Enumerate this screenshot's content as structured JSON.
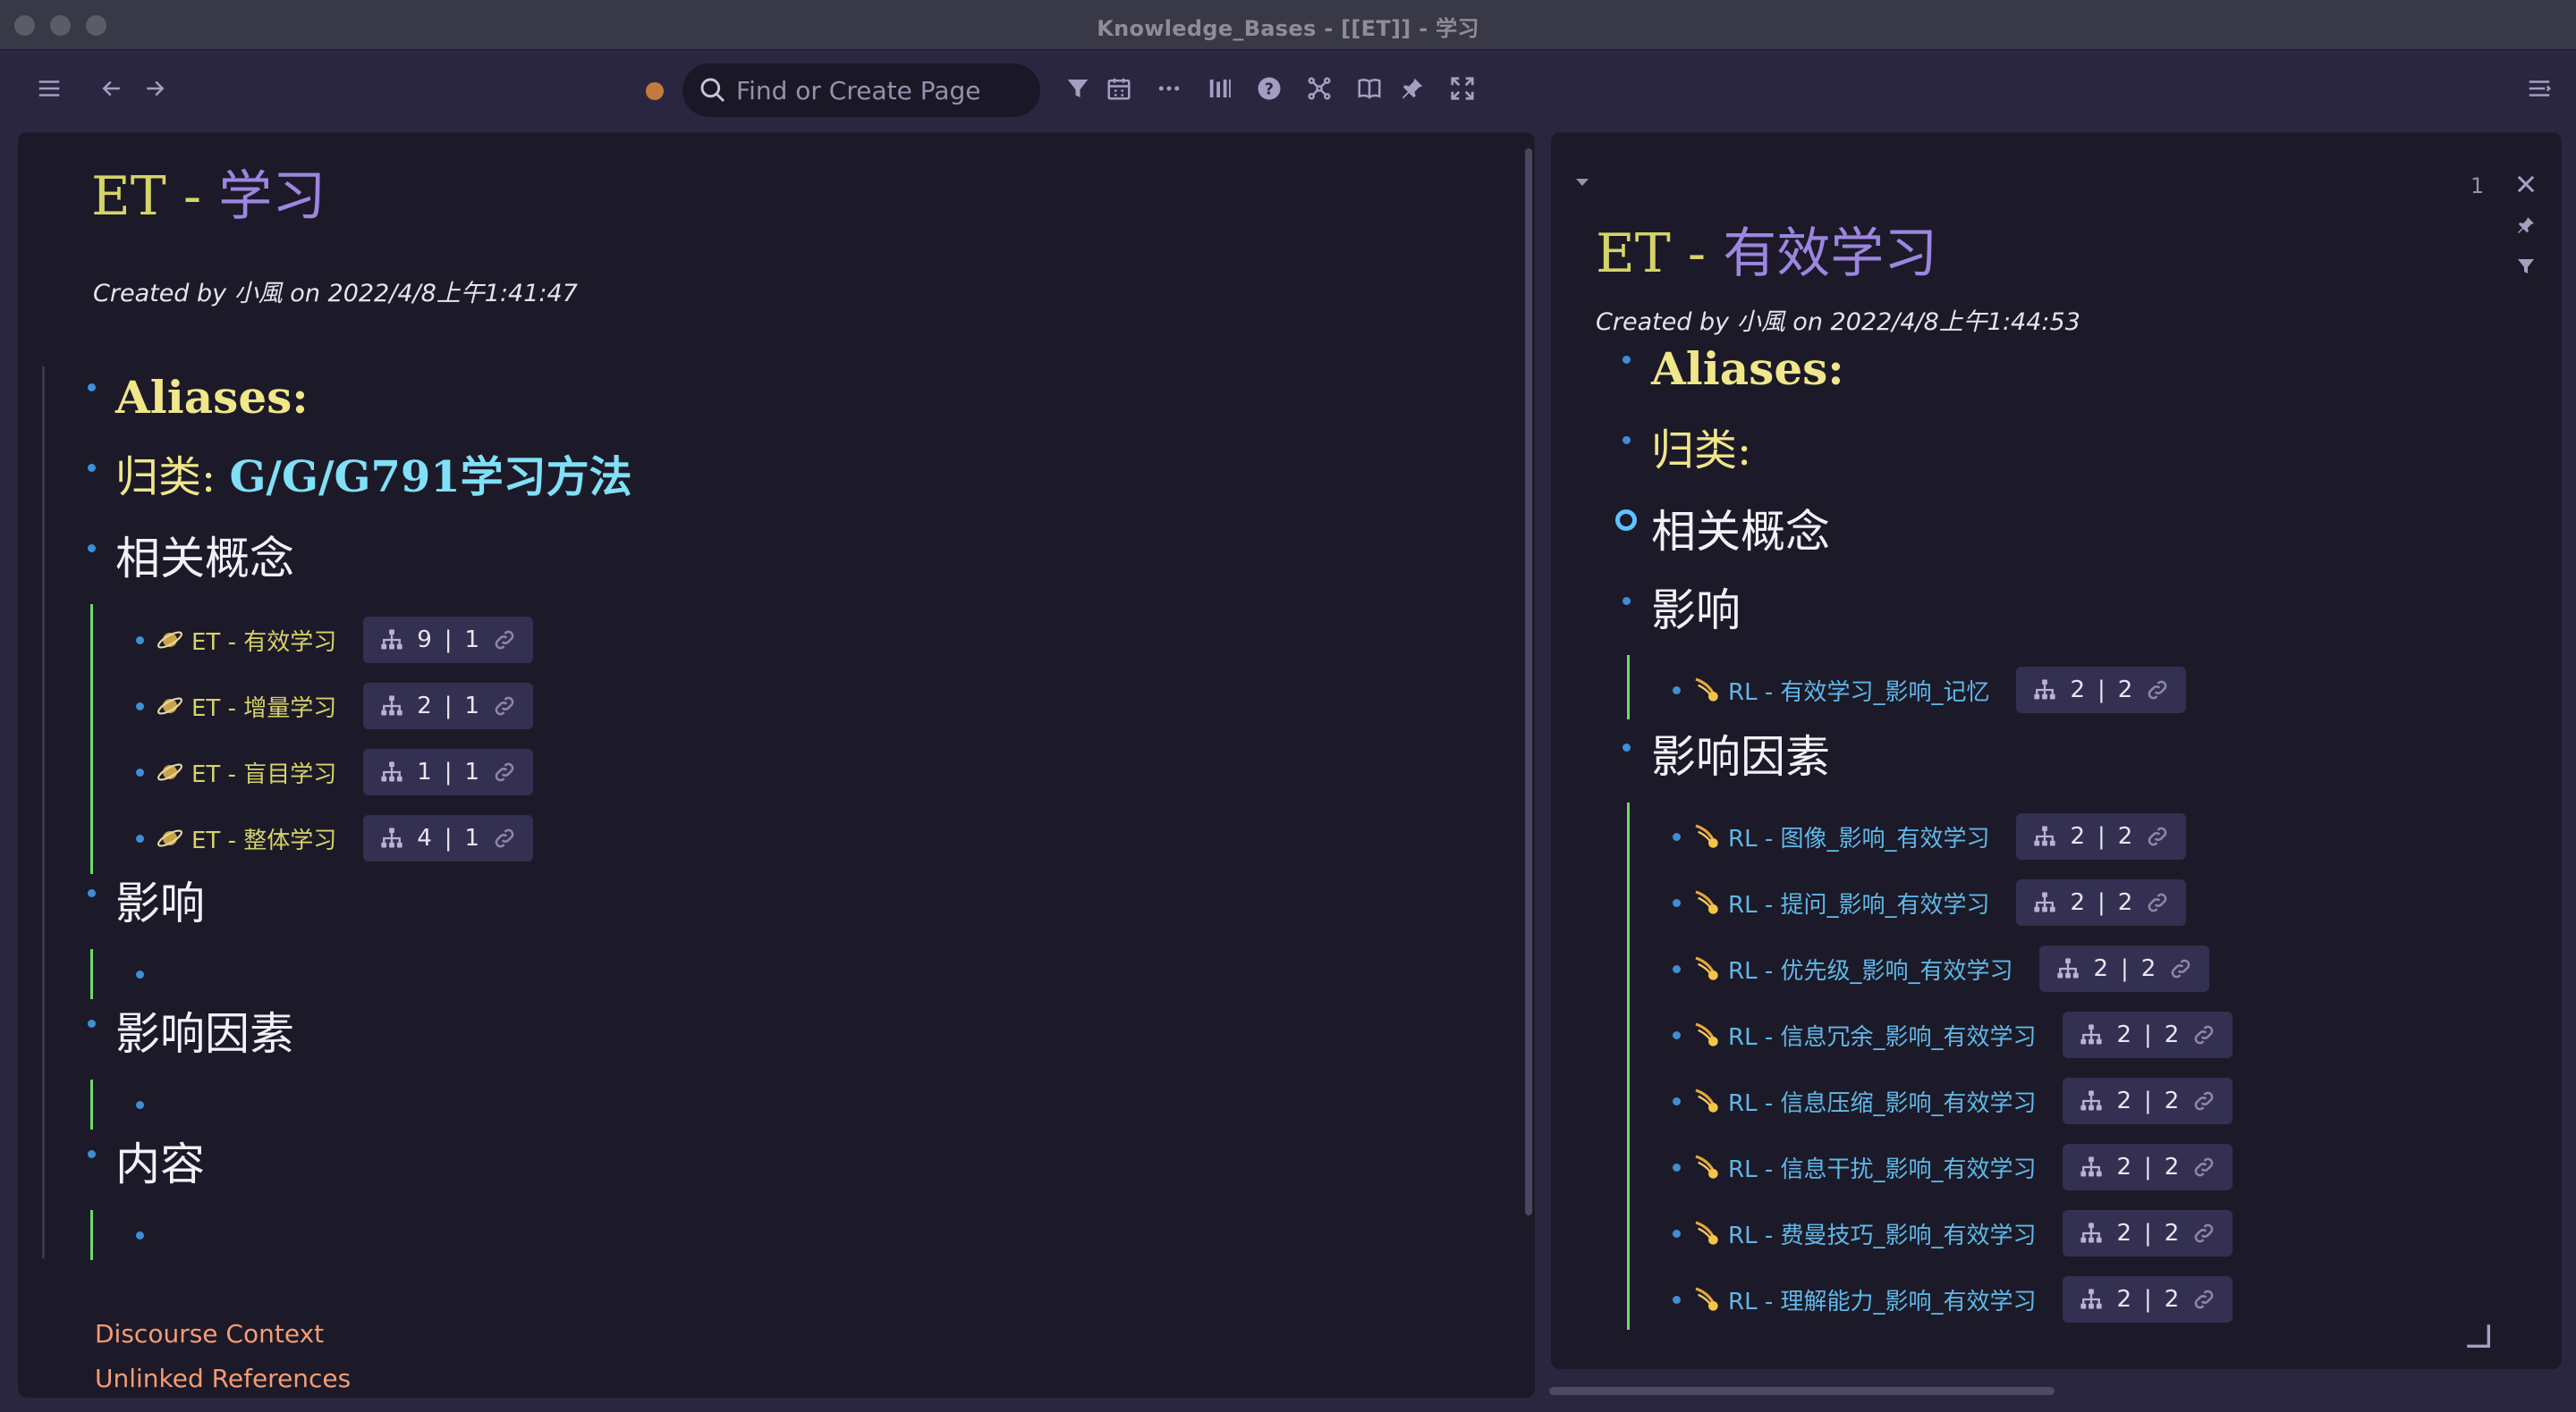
{
  "window": {
    "title": "Knowledge_Bases - [[ET]] - 学习"
  },
  "toolbar": {
    "search_placeholder": "Find or Create Page"
  },
  "main": {
    "title_prefix": "ET - ",
    "title_suffix": "学习",
    "created": "Created by 小風 on 2022/4/8上午1:41:47",
    "aliases": "Aliases:",
    "category_label": "归类: ",
    "category_value": "G/G/G791学习方法",
    "related": "相关概念",
    "related_items": [
      {
        "label": "ET - 有效学习",
        "a": "9",
        "b": "1"
      },
      {
        "label": "ET - 增量学习",
        "a": "2",
        "b": "1"
      },
      {
        "label": "ET - 盲目学习",
        "a": "1",
        "b": "1"
      },
      {
        "label": "ET - 整体学习",
        "a": "4",
        "b": "1"
      }
    ],
    "influence": "影响",
    "factors": "影响因素",
    "content": "内容",
    "discourse": "Discourse Context",
    "unlinked": "Unlinked References"
  },
  "side": {
    "count": "1",
    "title_prefix": "ET - ",
    "title_suffix": "有效学习",
    "created": "Created by 小風 on 2022/4/8上午1:44:53",
    "aliases": "Aliases:",
    "category_label": "归类:",
    "related": "相关概念",
    "influence": "影响",
    "influence_items": [
      {
        "label": "RL - 有效学习_影响_记忆",
        "a": "2",
        "b": "2"
      }
    ],
    "factors": "影响因素",
    "factor_items": [
      {
        "label": "RL - 图像_影响_有效学习",
        "a": "2",
        "b": "2"
      },
      {
        "label": "RL - 提问_影响_有效学习",
        "a": "2",
        "b": "2"
      },
      {
        "label": "RL - 优先级_影响_有效学习",
        "a": "2",
        "b": "2"
      },
      {
        "label": "RL - 信息冗余_影响_有效学习",
        "a": "2",
        "b": "2"
      },
      {
        "label": "RL - 信息压缩_影响_有效学习",
        "a": "2",
        "b": "2"
      },
      {
        "label": "RL - 信息干扰_影响_有效学习",
        "a": "2",
        "b": "2"
      },
      {
        "label": "RL - 费曼技巧_影响_有效学习",
        "a": "2",
        "b": "2"
      },
      {
        "label": "RL - 理解能力_影响_有效学习",
        "a": "2",
        "b": "2"
      }
    ]
  },
  "colors": {
    "et_link": "#d6d36a",
    "rl_link": "#5fb8e8",
    "accent_purple": "#9c86e0",
    "footer": "#f49b75"
  }
}
